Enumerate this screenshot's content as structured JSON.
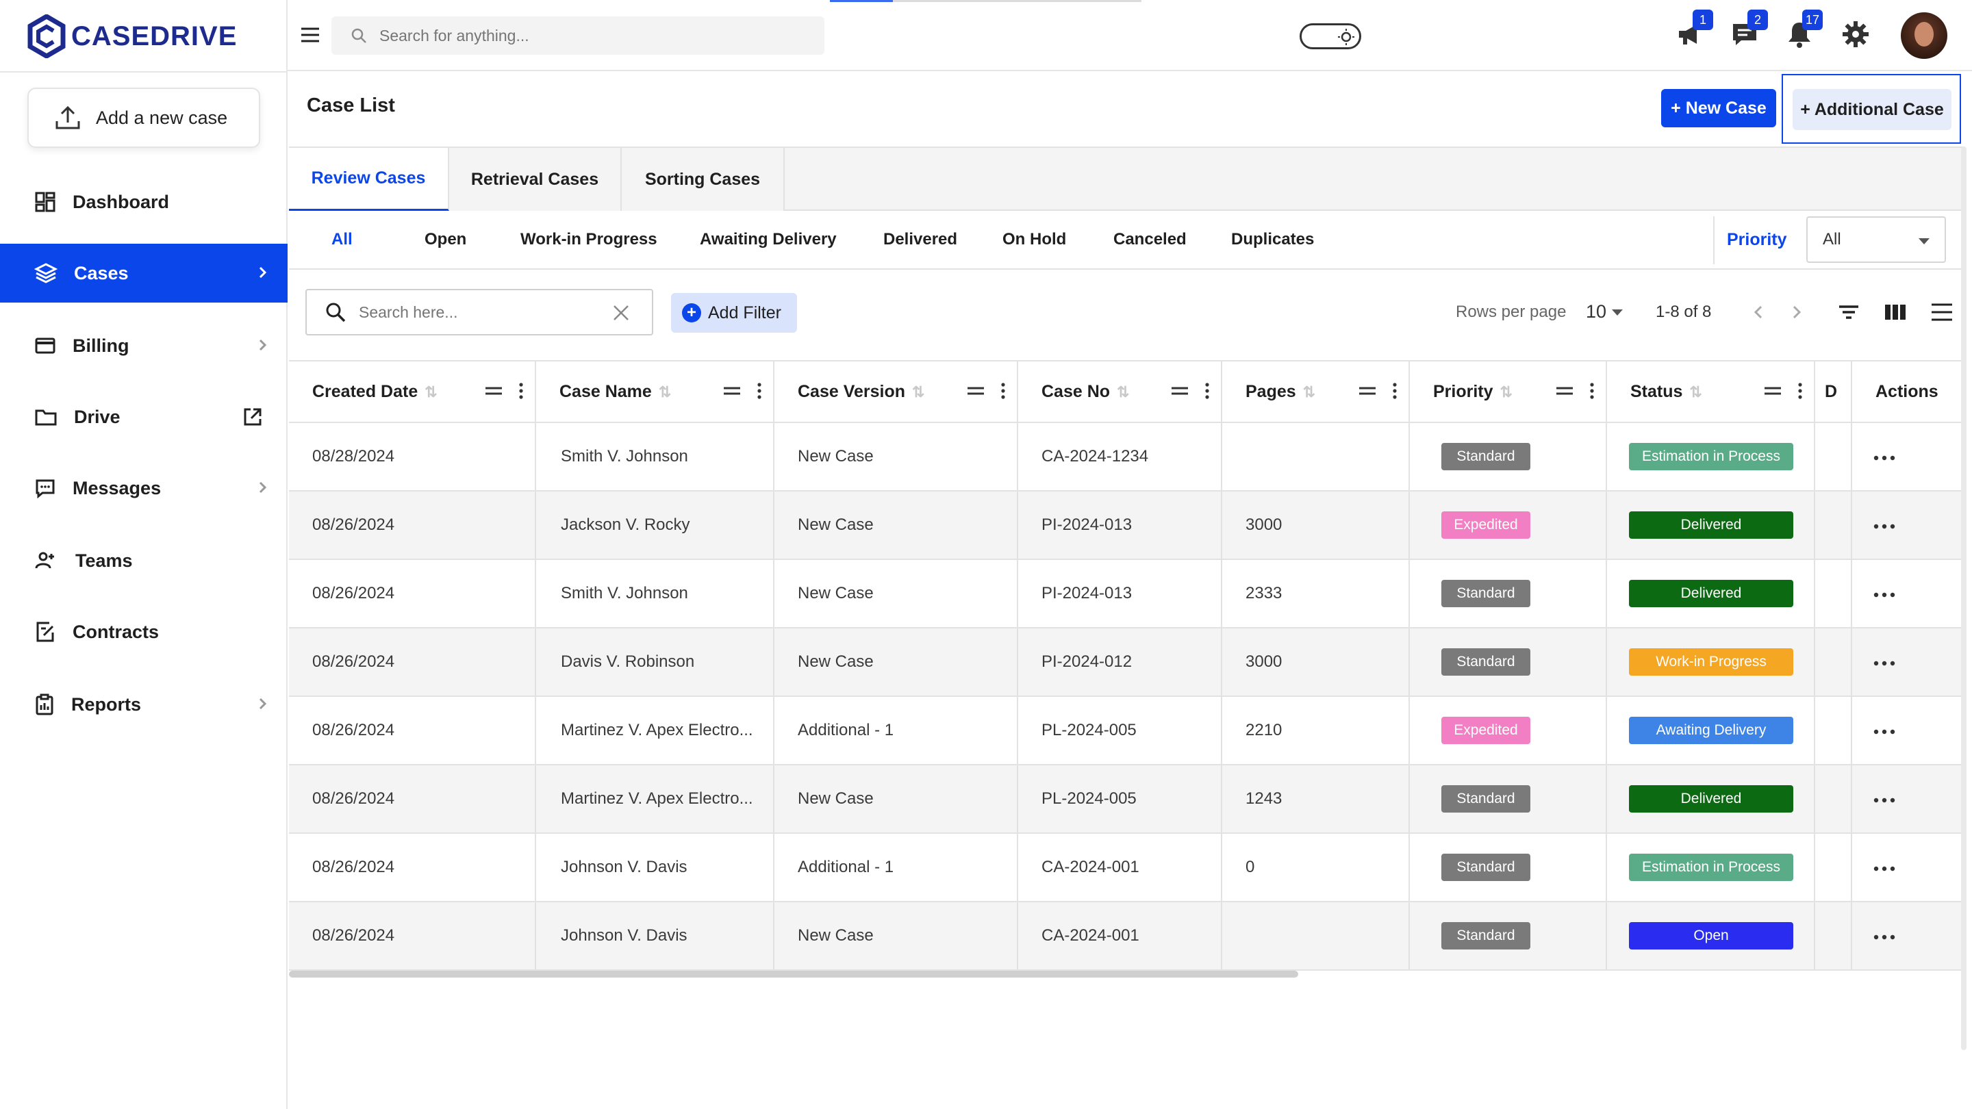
{
  "app": {
    "logo_text": "CASEDRIVE"
  },
  "sidebar": {
    "add_case_label": "Add a new case",
    "items": [
      {
        "label": "Dashboard",
        "icon": "dashboard-icon",
        "active": false,
        "chevron": false
      },
      {
        "label": "Cases",
        "icon": "layers-icon",
        "active": true,
        "chevron": true
      },
      {
        "label": "Billing",
        "icon": "card-icon",
        "active": false,
        "chevron": true
      },
      {
        "label": "Drive",
        "icon": "folder-icon",
        "active": false,
        "external": true
      },
      {
        "label": "Messages",
        "icon": "chat-icon",
        "active": false,
        "chevron": true
      },
      {
        "label": "Teams",
        "icon": "team-icon",
        "active": false,
        "chevron": false
      },
      {
        "label": "Contracts",
        "icon": "contract-icon",
        "active": false,
        "chevron": false
      },
      {
        "label": "Reports",
        "icon": "clipboard-icon",
        "active": false,
        "chevron": true
      }
    ]
  },
  "header": {
    "search_placeholder": "Search for anything...",
    "badges": {
      "announcements": "1",
      "messages": "2",
      "notifications": "17"
    }
  },
  "page": {
    "title": "Case List",
    "new_case_label": "+ New Case",
    "additional_case_label": "+ Additional Case"
  },
  "tabs": [
    "Review Cases",
    "Retrieval Cases",
    "Sorting Cases"
  ],
  "status_filters": [
    "All",
    "Open",
    "Work-in Progress",
    "Awaiting Delivery",
    "Delivered",
    "On Hold",
    "Canceled",
    "Duplicates"
  ],
  "priority_filter": {
    "label": "Priority",
    "value": "All"
  },
  "table_toolbar": {
    "search_placeholder": "Search here...",
    "add_filter_label": "Add Filter",
    "rows_per_page_label": "Rows per page",
    "rows_per_page_value": "10",
    "range_text": "1-8 of 8"
  },
  "table": {
    "columns": [
      "Created Date",
      "Case Name",
      "Case Version",
      "Case No",
      "Pages",
      "Priority",
      "Status",
      "D",
      "Actions"
    ],
    "rows": [
      {
        "date": "08/28/2024",
        "name": "Smith V. Johnson",
        "version": "New Case",
        "case_no": "CA-2024-1234",
        "pages": "",
        "priority": "Standard",
        "status": "Estimation in Process"
      },
      {
        "date": "08/26/2024",
        "name": "Jackson V. Rocky",
        "version": "New Case",
        "case_no": "PI-2024-013",
        "pages": "3000",
        "priority": "Expedited",
        "status": "Delivered"
      },
      {
        "date": "08/26/2024",
        "name": "Smith V. Johnson",
        "version": "New Case",
        "case_no": "PI-2024-013",
        "pages": "2333",
        "priority": "Standard",
        "status": "Delivered"
      },
      {
        "date": "08/26/2024",
        "name": "Davis V. Robinson",
        "version": "New Case",
        "case_no": "PI-2024-012",
        "pages": "3000",
        "priority": "Standard",
        "status": "Work-in Progress"
      },
      {
        "date": "08/26/2024",
        "name": "Martinez V. Apex Electro...",
        "version": "Additional - 1",
        "case_no": "PL-2024-005",
        "pages": "2210",
        "priority": "Expedited",
        "status": "Awaiting Delivery"
      },
      {
        "date": "08/26/2024",
        "name": "Martinez V. Apex Electro...",
        "version": "New Case",
        "case_no": "PL-2024-005",
        "pages": "1243",
        "priority": "Standard",
        "status": "Delivered"
      },
      {
        "date": "08/26/2024",
        "name": "Johnson V. Davis",
        "version": "Additional - 1",
        "case_no": "CA-2024-001",
        "pages": "0",
        "priority": "Standard",
        "status": "Estimation in Process"
      },
      {
        "date": "08/26/2024",
        "name": "Johnson V. Davis",
        "version": "New Case",
        "case_no": "CA-2024-001",
        "pages": "",
        "priority": "Standard",
        "status": "Open"
      }
    ]
  },
  "colors": {
    "primary": "#0b46ea",
    "priority": {
      "Standard": "#7a7a7a",
      "Expedited": "#f27fc4"
    },
    "status": {
      "Estimation in Process": "#5aab88",
      "Delivered": "#0c6b12",
      "Work-in Progress": "#f5a623",
      "Awaiting Delivery": "#3d84e6",
      "Open": "#2a2df0"
    }
  }
}
